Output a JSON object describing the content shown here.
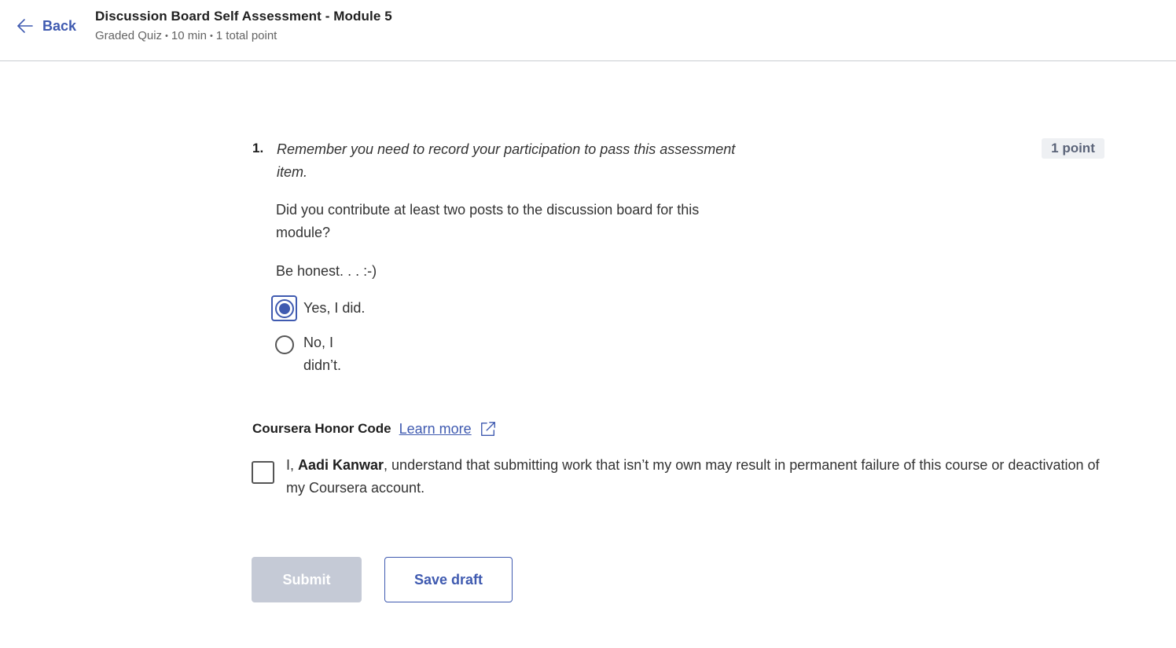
{
  "header": {
    "back_label": "Back",
    "title": "Discussion Board Self Assessment - Module 5",
    "meta": [
      "Graded Quiz",
      "10 min",
      "1 total point"
    ],
    "meta_separator": "•"
  },
  "question": {
    "number": "1.",
    "prompt_italic": "Remember you need to record your participation to pass this assessment item.",
    "points": "1 point",
    "text": "Did you contribute at least two posts to the discussion board for this module?",
    "note": "Be honest. . . :-)",
    "options": [
      {
        "label": "Yes, I did.",
        "selected": true
      },
      {
        "label": "No, I didn’t.",
        "selected": false
      }
    ]
  },
  "honor": {
    "title": "Coursera Honor Code",
    "learn_more": "Learn more",
    "statement_prefix": "I, ",
    "user_name": "Aadi Kanwar",
    "statement_suffix": ", understand that submitting work that isn’t my own may result in permanent failure of this course or deactivation of my Coursera account.",
    "checked": false
  },
  "actions": {
    "submit_label": "Submit",
    "save_label": "Save draft"
  },
  "colors": {
    "accent": "#3f5ab0",
    "disabled_button": "#c5cad6"
  }
}
